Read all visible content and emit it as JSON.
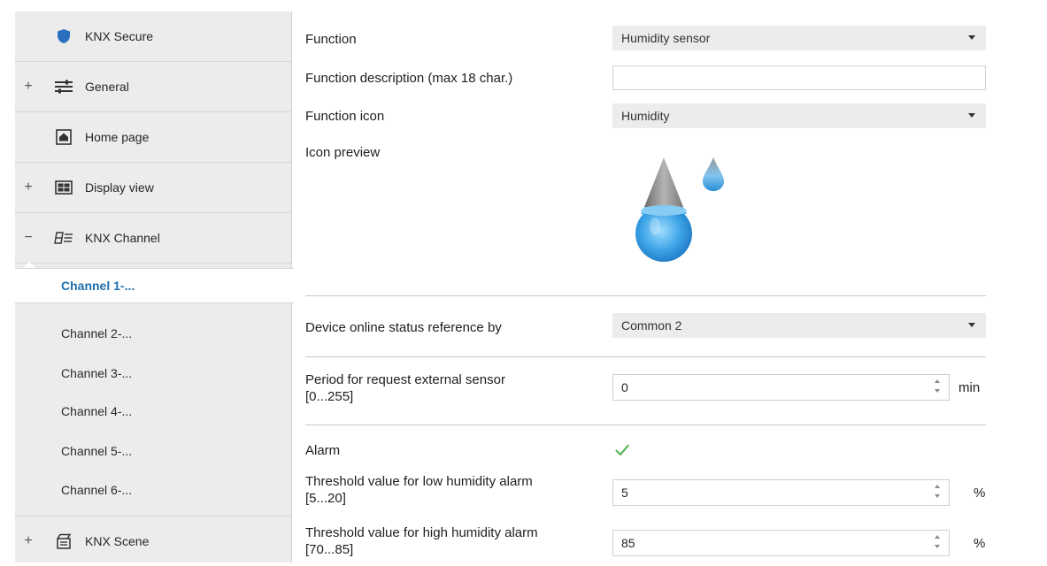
{
  "sidebar": {
    "items": [
      {
        "expander": "",
        "icon": "shield-icon",
        "label": "KNX Secure"
      },
      {
        "expander": "+",
        "icon": "sliders-icon",
        "label": "General"
      },
      {
        "expander": "",
        "icon": "home-icon",
        "label": "Home page"
      },
      {
        "expander": "+",
        "icon": "display-view-icon",
        "label": "Display view"
      },
      {
        "expander": "−",
        "icon": "channel-icon",
        "label": "KNX Channel"
      }
    ],
    "channels": [
      "Channel 1-...",
      "Channel 2-...",
      "Channel 3-...",
      "Channel 4-...",
      "Channel 5-...",
      "Channel 6-..."
    ],
    "active_channel": "Channel 1-...",
    "scene": {
      "expander": "+",
      "icon": "scene-icon",
      "label": "KNX Scene"
    }
  },
  "main": {
    "function": {
      "label": "Function",
      "value": "Humidity sensor"
    },
    "function_description": {
      "label": "Function description (max 18 char.)",
      "value": ""
    },
    "function_icon": {
      "label": "Function icon",
      "value": "Humidity"
    },
    "icon_preview": {
      "label": "Icon preview",
      "icon": "humidity-drops-icon"
    },
    "online_status": {
      "label": "Device online status reference by",
      "value": "Common 2"
    },
    "request_period": {
      "label_line1": "Period for request external sensor",
      "label_line2": "[0...255]",
      "value": "0",
      "unit": "min"
    },
    "alarm": {
      "label": "Alarm",
      "checked": true
    },
    "low_alarm": {
      "label_line1": "Threshold value for low humidity alarm",
      "label_line2": "[5...20]",
      "value": "5",
      "unit": "%"
    },
    "high_alarm": {
      "label_line1": "Threshold value for high humidity alarm",
      "label_line2": "[70...85]",
      "value": "85",
      "unit": "%"
    }
  },
  "colors": {
    "accent": "#1f6fae",
    "sidebar_bg": "#ececec",
    "check": "#5cb85c",
    "drop_blue": "#3aa2e6"
  }
}
